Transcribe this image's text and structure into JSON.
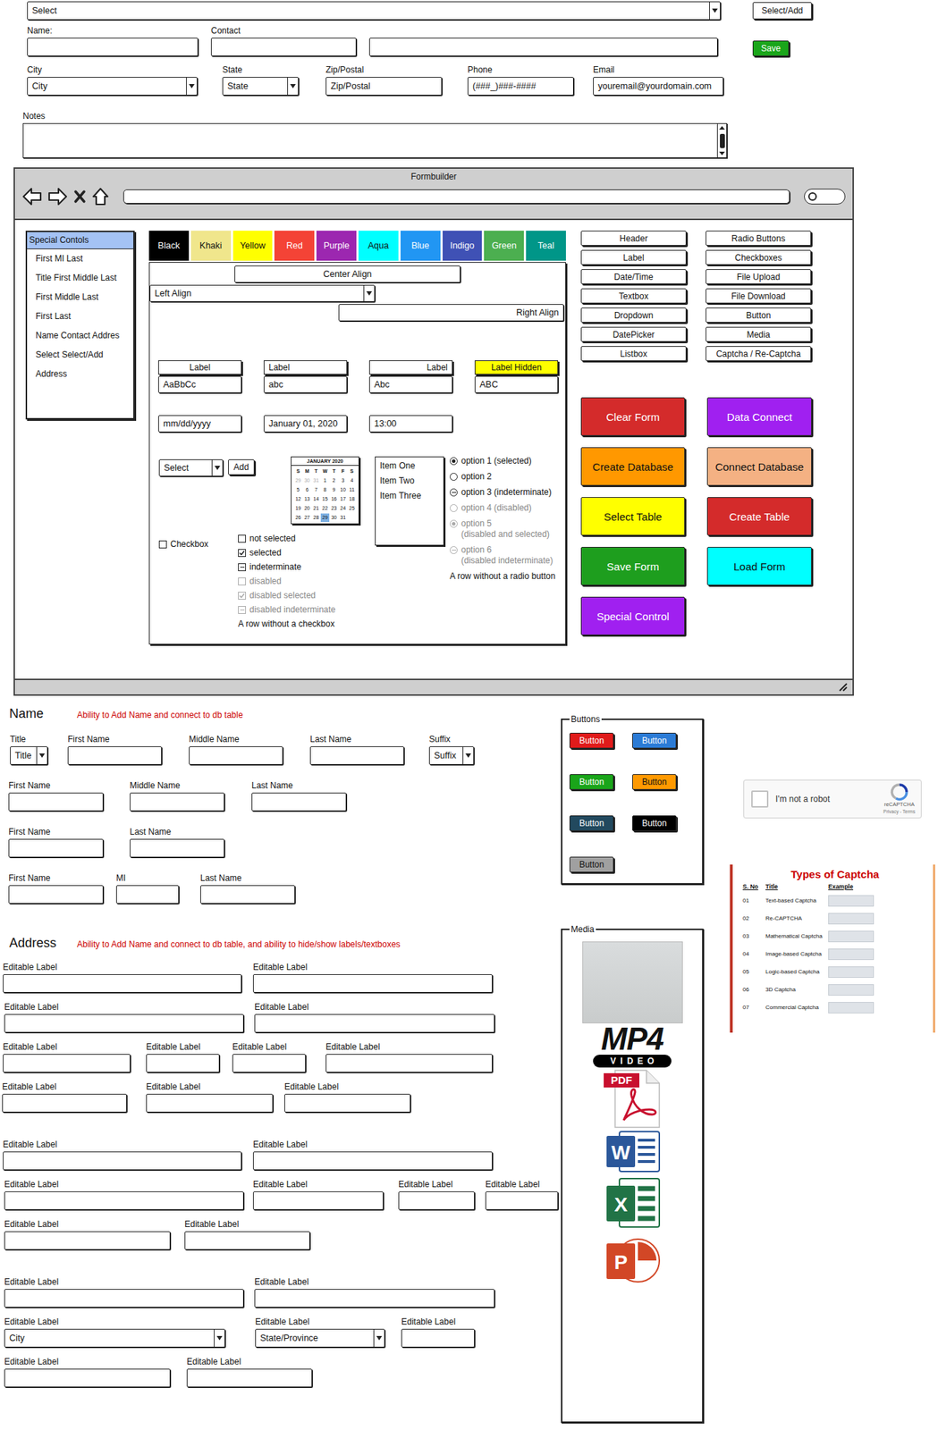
{
  "top_form": {
    "select": "Select",
    "select_add": "Select/Add",
    "row_fields": [
      {
        "label": "Name:",
        "value": ""
      },
      {
        "label": "Contact",
        "value": ""
      },
      {
        "label": "",
        "value": ""
      }
    ],
    "save": "Save",
    "address_fields": [
      {
        "label": "City",
        "value": "City",
        "kind": "dropdown"
      },
      {
        "label": "State",
        "value": "State",
        "kind": "dropdown"
      },
      {
        "label": "Zip/Postal",
        "value": "Zip/Postal",
        "kind": "textbox"
      },
      {
        "label": "Phone",
        "value": "(###_)###-####",
        "kind": "textbox"
      },
      {
        "label": "Email",
        "value": "youremail@yourdomain.com",
        "kind": "textbox"
      }
    ],
    "notes_label": "Notes"
  },
  "window": {
    "title": "Formbuilder"
  },
  "sidebar": {
    "items": [
      {
        "label": "Special Contols",
        "selected": true
      },
      {
        "label": "First MI Last",
        "selected": false
      },
      {
        "label": "Title First Middle Last",
        "selected": false
      },
      {
        "label": "First Middle Last",
        "selected": false
      },
      {
        "label": "First Last",
        "selected": false
      },
      {
        "label": "Name Contact Addres",
        "selected": false
      },
      {
        "label": "Select Select/Add",
        "selected": false
      },
      {
        "label": "Address",
        "selected": false
      }
    ]
  },
  "color_buttons": [
    {
      "label": "Black",
      "color": "#000000"
    },
    {
      "label": "Khaki",
      "color": "#f0e68c"
    },
    {
      "label": "Yellow",
      "color": "#ffff00"
    },
    {
      "label": "Red",
      "color": "#f44336"
    },
    {
      "label": "Purple",
      "color": "#9c27b0"
    },
    {
      "label": "Aqua",
      "color": "#00ffff"
    },
    {
      "label": "Blue",
      "color": "#2196f3"
    },
    {
      "label": "Indigo",
      "color": "#3f51b5"
    },
    {
      "label": "Green",
      "color": "#4caf50"
    },
    {
      "label": "Teal",
      "color": "#009688"
    }
  ],
  "align": {
    "center": "Center Align",
    "left": "Left Align",
    "right": "Right Align"
  },
  "label_fields": [
    {
      "label": "Label",
      "value": "AaBbCc",
      "align": "center",
      "hidden": false
    },
    {
      "label": "Label",
      "value": "abc",
      "align": "left",
      "hidden": false
    },
    {
      "label": "Label",
      "value": "Abc",
      "align": "right",
      "hidden": false
    },
    {
      "label": "Label Hidden",
      "value": "ABC",
      "align": "center",
      "hidden": true
    }
  ],
  "date_fields": [
    "mm/dd/yyyy",
    "January 01, 2020",
    "13:00"
  ],
  "select_add": {
    "value": "Select",
    "button": "Add"
  },
  "calendar": {
    "title": "JANUARY 2020",
    "weekdays": [
      "S",
      "M",
      "T",
      "W",
      "T",
      "F",
      "S"
    ],
    "days": [
      {
        "day": "29",
        "muted": true,
        "selected": false
      },
      {
        "day": "30",
        "muted": true,
        "selected": false
      },
      {
        "day": "31",
        "muted": true,
        "selected": false
      },
      {
        "day": "1",
        "muted": false,
        "selected": false
      },
      {
        "day": "2",
        "muted": false,
        "selected": false
      },
      {
        "day": "3",
        "muted": false,
        "selected": false
      },
      {
        "day": "4",
        "muted": false,
        "selected": false
      },
      {
        "day": "5",
        "muted": false,
        "selected": false
      },
      {
        "day": "6",
        "muted": false,
        "selected": false
      },
      {
        "day": "7",
        "muted": false,
        "selected": false
      },
      {
        "day": "8",
        "muted": false,
        "selected": false
      },
      {
        "day": "9",
        "muted": false,
        "selected": false
      },
      {
        "day": "10",
        "muted": false,
        "selected": false
      },
      {
        "day": "11",
        "muted": false,
        "selected": false
      },
      {
        "day": "12",
        "muted": false,
        "selected": false
      },
      {
        "day": "13",
        "muted": false,
        "selected": false
      },
      {
        "day": "14",
        "muted": false,
        "selected": false
      },
      {
        "day": "15",
        "muted": false,
        "selected": false
      },
      {
        "day": "16",
        "muted": false,
        "selected": false
      },
      {
        "day": "17",
        "muted": false,
        "selected": false
      },
      {
        "day": "18",
        "muted": false,
        "selected": false
      },
      {
        "day": "19",
        "muted": false,
        "selected": false
      },
      {
        "day": "20",
        "muted": false,
        "selected": false
      },
      {
        "day": "21",
        "muted": false,
        "selected": false
      },
      {
        "day": "22",
        "muted": false,
        "selected": false
      },
      {
        "day": "23",
        "muted": false,
        "selected": false
      },
      {
        "day": "24",
        "muted": false,
        "selected": false
      },
      {
        "day": "25",
        "muted": false,
        "selected": false
      },
      {
        "day": "26",
        "muted": false,
        "selected": false
      },
      {
        "day": "27",
        "muted": false,
        "selected": false
      },
      {
        "day": "28",
        "muted": false,
        "selected": false
      },
      {
        "day": "29",
        "muted": false,
        "selected": true
      },
      {
        "day": "30",
        "muted": false,
        "selected": false
      },
      {
        "day": "31",
        "muted": false,
        "selected": false
      }
    ]
  },
  "listbox": {
    "items": [
      {
        "label": "Item One",
        "selected": false
      },
      {
        "label": "Item Two",
        "selected": false
      },
      {
        "label": "Item Three",
        "selected": false
      }
    ]
  },
  "radios": [
    {
      "label": "option 1 (selected)",
      "note": "",
      "kind": "radio",
      "selected": true,
      "indeterminate": false,
      "disabled": false
    },
    {
      "label": "option 2",
      "note": "",
      "kind": "radio",
      "selected": false,
      "indeterminate": false,
      "disabled": false
    },
    {
      "label": "option 3 (indeterminate)",
      "note": "",
      "kind": "radio",
      "selected": false,
      "indeterminate": true,
      "disabled": false
    },
    {
      "label": "option 4 (disabled)",
      "note": "",
      "kind": "radio",
      "selected": false,
      "indeterminate": false,
      "disabled": true
    },
    {
      "label": "option 5",
      "note": "(disabled and selected)",
      "kind": "radio",
      "selected": true,
      "indeterminate": false,
      "disabled": true
    },
    {
      "label": "option 6",
      "note": "(disabled indeterminate)",
      "kind": "radio",
      "selected": false,
      "indeterminate": true,
      "disabled": true
    },
    {
      "label": "A row without a radio button",
      "note": "",
      "kind": "plain",
      "selected": false,
      "indeterminate": false,
      "disabled": false
    }
  ],
  "checkbox": {
    "label": "Checkbox",
    "checked": false
  },
  "checkboxes": [
    {
      "label": "not selected",
      "kind": "checkbox",
      "checked": false,
      "indeterminate": false,
      "disabled": false
    },
    {
      "label": "selected",
      "kind": "checkbox",
      "checked": true,
      "indeterminate": false,
      "disabled": false
    },
    {
      "label": "indeterminate",
      "kind": "checkbox",
      "checked": false,
      "indeterminate": true,
      "disabled": false
    },
    {
      "label": "disabled",
      "kind": "checkbox",
      "checked": false,
      "indeterminate": false,
      "disabled": true
    },
    {
      "label": "disabled selected",
      "kind": "checkbox",
      "checked": true,
      "indeterminate": false,
      "disabled": true
    },
    {
      "label": "disabled indeterminate",
      "kind": "checkbox",
      "checked": false,
      "indeterminate": true,
      "disabled": true
    },
    {
      "label": "A row without a checkbox",
      "kind": "plain",
      "checked": false,
      "indeterminate": false,
      "disabled": false
    }
  ],
  "palette": {
    "left": [
      "Header",
      "Label",
      "Date/Time",
      "Textbox",
      "Dropdown",
      "DatePicker",
      "Listbox"
    ],
    "right": [
      "Radio Buttons",
      "Checkboxes",
      "File Upload",
      "File Download",
      "Button",
      "Media",
      "Captcha / Re-Captcha"
    ]
  },
  "actions": [
    {
      "label": "Clear Form",
      "color": "#d42b2b"
    },
    {
      "label": "Data Connect",
      "color": "#a020f0"
    },
    {
      "label": "Create Database",
      "color": "#ff9800"
    },
    {
      "label": "Connect Database",
      "color": "#f4b183"
    },
    {
      "label": "Select Table",
      "color": "#ffff00"
    },
    {
      "label": "Create Table",
      "color": "#d42b2b"
    },
    {
      "label": "Save Form",
      "color": "#1e9e1e"
    },
    {
      "label": "Load Form",
      "color": "#00ffff"
    },
    {
      "label": "Special Control",
      "color": "#a020f0"
    }
  ],
  "name_section": {
    "title": "Name",
    "note": "Ability to Add Name and connect to db table",
    "rows": [
      [
        {
          "label": "Title",
          "kind": "dropdown",
          "value": "Title"
        },
        {
          "label": "First Name",
          "kind": "textbox",
          "value": ""
        },
        {
          "label": "Middle Name",
          "kind": "textbox",
          "value": ""
        },
        {
          "label": "Last Name",
          "kind": "textbox",
          "value": ""
        },
        {
          "label": "Suffix",
          "kind": "dropdown",
          "value": "Suffix"
        }
      ],
      [
        {
          "label": "First Name",
          "kind": "textbox",
          "value": ""
        },
        {
          "label": "Middle Name",
          "kind": "textbox",
          "value": ""
        },
        {
          "label": "Last Name",
          "kind": "textbox",
          "value": ""
        }
      ],
      [
        {
          "label": "First Name",
          "kind": "textbox",
          "value": ""
        },
        {
          "label": "Last  Name",
          "kind": "textbox",
          "value": ""
        }
      ],
      [
        {
          "label": "First Name",
          "kind": "textbox",
          "value": ""
        },
        {
          "label": "MI",
          "kind": "textbox",
          "value": ""
        },
        {
          "label": "Last  Name",
          "kind": "textbox",
          "value": ""
        }
      ]
    ]
  },
  "address_section": {
    "title": "Address",
    "note": "Ability to Add Name and connect to db table, and ability to hide/show labels/textboxes",
    "groups": [
      [
        [
          {
            "label": "Editable Label",
            "kind": "textbox",
            "value": ""
          },
          {
            "label": "Editable Label",
            "kind": "textbox",
            "value": ""
          }
        ],
        [
          {
            "label": "Editable Label",
            "kind": "textbox",
            "value": ""
          },
          {
            "label": "Editable Label",
            "kind": "textbox",
            "value": ""
          }
        ],
        [
          {
            "label": "Editable Label",
            "kind": "textbox",
            "value": ""
          },
          {
            "label": "Editable Label",
            "kind": "textbox",
            "value": ""
          },
          {
            "label": "Editable Label",
            "kind": "textbox",
            "value": ""
          },
          {
            "label": "Editable Label",
            "kind": "textbox",
            "value": ""
          }
        ],
        [
          {
            "label": "Editable Label",
            "kind": "textbox",
            "value": ""
          },
          {
            "label": "Editable Label",
            "kind": "textbox",
            "value": ""
          },
          {
            "label": "Editable Label",
            "kind": "textbox",
            "value": ""
          }
        ]
      ],
      [
        [
          {
            "label": "Editable Label",
            "kind": "textbox",
            "value": ""
          },
          {
            "label": "Editable Label",
            "kind": "textbox",
            "value": ""
          }
        ],
        [
          {
            "label": "Editable Label",
            "kind": "textbox",
            "value": ""
          },
          {
            "label": "Editable Label",
            "kind": "textbox",
            "value": ""
          },
          {
            "label": "Editable Label",
            "kind": "textbox",
            "value": ""
          },
          {
            "label": "Editable Label",
            "kind": "textbox",
            "value": ""
          }
        ],
        [
          {
            "label": "Editable Label",
            "kind": "textbox",
            "value": ""
          },
          {
            "label": "Editable Label",
            "kind": "textbox",
            "value": ""
          }
        ]
      ],
      [
        [
          {
            "label": "Editable Label",
            "kind": "textbox",
            "value": ""
          },
          {
            "label": "Editable Label",
            "kind": "textbox",
            "value": ""
          }
        ],
        [
          {
            "label": "Editable Label",
            "kind": "dropdown",
            "value": "City"
          },
          {
            "label": "Editable Label",
            "kind": "dropdown",
            "value": "State/Province"
          },
          {
            "label": "Editable Label",
            "kind": "textbox",
            "value": ""
          }
        ],
        [
          {
            "label": "Editable Label",
            "kind": "textbox",
            "value": ""
          },
          {
            "label": "Editable Label",
            "kind": "textbox",
            "value": ""
          }
        ]
      ]
    ]
  },
  "buttons_group": {
    "title": "Buttons",
    "items": [
      {
        "label": "Button",
        "color": "#e01b1b"
      },
      {
        "label": "Button",
        "color": "#2b7bd6"
      },
      {
        "label": "Button",
        "color": "#1aa51a"
      },
      {
        "label": "Button",
        "color": "#ff9900"
      },
      {
        "label": "Button",
        "color": "#22495e"
      },
      {
        "label": "Button",
        "color": "#000000"
      },
      {
        "label": "Button",
        "color": "#a0a0a0"
      }
    ]
  },
  "media": {
    "title": "Media",
    "items": [
      {
        "kind": "photo",
        "text": "",
        "subtext": ""
      },
      {
        "kind": "mp4",
        "text": "MP4",
        "subtext": "VIDEO"
      },
      {
        "kind": "pdf",
        "text": "PDF",
        "subtext": ""
      },
      {
        "kind": "word",
        "text": "W",
        "subtext": ""
      },
      {
        "kind": "excel",
        "text": "X",
        "subtext": ""
      },
      {
        "kind": "powerpoint",
        "text": "P",
        "subtext": ""
      }
    ]
  },
  "recaptcha": {
    "label": "I'm not a robot",
    "checked": false,
    "brand": "reCAPTCHA",
    "links": "Privacy - Terms"
  },
  "captcha_table": {
    "title": "Types of Captcha",
    "columns": [
      "S. No",
      "Title",
      "Example"
    ],
    "rows": [
      {
        "no": "01",
        "title": "Text-based Captcha"
      },
      {
        "no": "02",
        "title": "Re-CAPTCHA"
      },
      {
        "no": "03",
        "title": "Mathematical Captcha"
      },
      {
        "no": "04",
        "title": "Image-based Captcha"
      },
      {
        "no": "05",
        "title": "Logic-based Captcha"
      },
      {
        "no": "06",
        "title": "3D Captcha"
      },
      {
        "no": "07",
        "title": "Commercial Captcha"
      }
    ]
  }
}
